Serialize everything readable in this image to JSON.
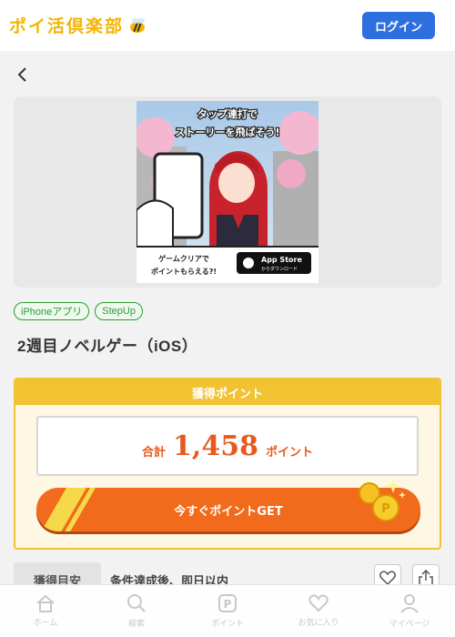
{
  "header": {
    "logo_text": "ポイ活倶楽部",
    "login_label": "ログイン"
  },
  "banner": {
    "headline_line1": "タップ連打で",
    "headline_line2": "ストーリーを飛ばそう!",
    "footer_text_line1": "ゲームクリアで",
    "footer_text_line2": "ポイントもらえる?!",
    "store_badge_line1": "App Store",
    "store_badge_line2": "からダウンロード"
  },
  "tags": [
    "iPhoneアプリ",
    "StepUp"
  ],
  "app_title": "2週目ノベルゲー（iOS）",
  "points": {
    "heading": "獲得ポイント",
    "total_label": "合計",
    "total_value": "1,458",
    "unit": "ポイント",
    "get_button_label": "今すぐポイントGET"
  },
  "meta": {
    "label": "獲得目安",
    "value": "条件達成後、即日以内"
  },
  "bottom_nav": [
    {
      "label": "ホーム",
      "icon": "home-icon"
    },
    {
      "label": "検索",
      "icon": "search-icon"
    },
    {
      "label": "ポイント",
      "icon": "point-icon"
    },
    {
      "label": "お気に入り",
      "icon": "heart-icon"
    },
    {
      "label": "マイページ",
      "icon": "user-icon"
    }
  ],
  "colors": {
    "brand_yellow": "#f4b400",
    "login_blue": "#2e6fe0",
    "accent_orange": "#f26a1b",
    "tag_green": "#2e9b35"
  }
}
